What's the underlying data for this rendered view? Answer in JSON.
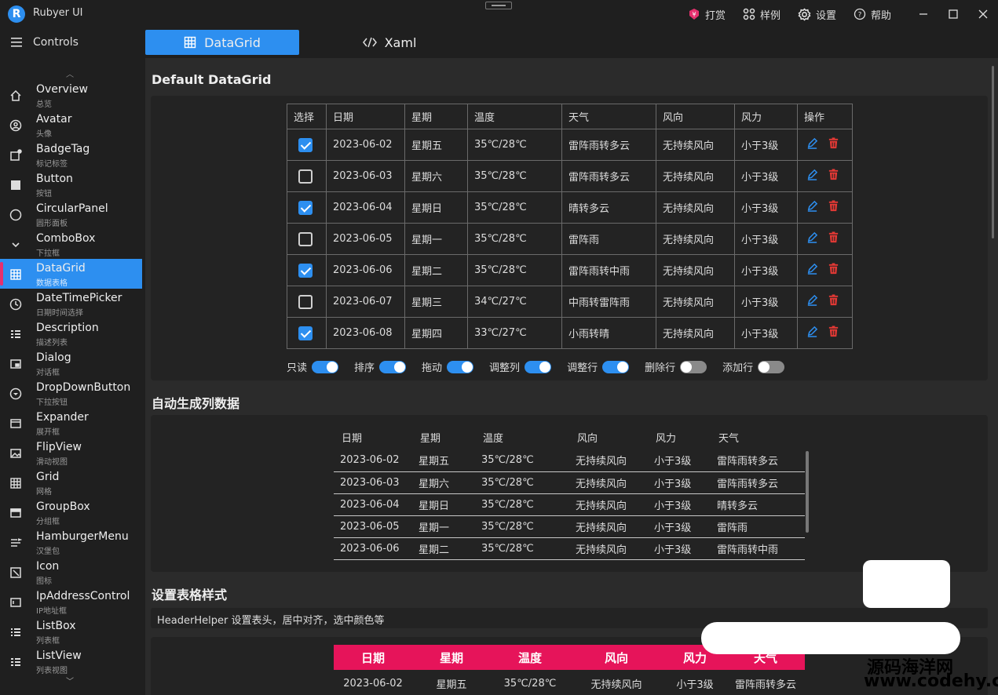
{
  "app": {
    "title": "Rubyer UI",
    "logo_letter": "R",
    "accent": "#2d8ff0",
    "highlight": "#e6145a"
  },
  "titlebar": {
    "items": [
      {
        "label": "打赏",
        "icon": "donate-icon"
      },
      {
        "label": "样例",
        "icon": "grid-icon"
      },
      {
        "label": "设置",
        "icon": "gear-icon"
      },
      {
        "label": "帮助",
        "icon": "help-icon"
      }
    ]
  },
  "sidebar": {
    "header": "Controls",
    "items": [
      {
        "en": "Overview",
        "zh": "总览"
      },
      {
        "en": "Avatar",
        "zh": "头像"
      },
      {
        "en": "BadgeTag",
        "zh": "标记标签"
      },
      {
        "en": "Button",
        "zh": "按钮"
      },
      {
        "en": "CircularPanel",
        "zh": "圆形面板"
      },
      {
        "en": "ComboBox",
        "zh": "下拉框"
      },
      {
        "en": "DataGrid",
        "zh": "数据表格"
      },
      {
        "en": "DateTimePicker",
        "zh": "日期时间选择"
      },
      {
        "en": "Description",
        "zh": "描述列表"
      },
      {
        "en": "Dialog",
        "zh": "对话框"
      },
      {
        "en": "DropDownButton",
        "zh": "下拉按钮"
      },
      {
        "en": "Expander",
        "zh": "展开框"
      },
      {
        "en": "FlipView",
        "zh": "滑动视图"
      },
      {
        "en": "Grid",
        "zh": "网格"
      },
      {
        "en": "GroupBox",
        "zh": "分组框"
      },
      {
        "en": "HamburgerMenu",
        "zh": "汉堡包"
      },
      {
        "en": "Icon",
        "zh": "图标"
      },
      {
        "en": "IpAddressControl",
        "zh": "IP地址框"
      },
      {
        "en": "ListBox",
        "zh": "列表框"
      },
      {
        "en": "ListView",
        "zh": "列表视图"
      }
    ]
  },
  "tabs": {
    "datagrid": "DataGrid",
    "xaml": "Xaml"
  },
  "section1": {
    "title": "Default DataGrid",
    "headers": [
      "选择",
      "日期",
      "星期",
      "温度",
      "天气",
      "风向",
      "风力",
      "操作"
    ],
    "rows": [
      {
        "checked": true,
        "date": "2023-06-02",
        "weekday": "星期五",
        "temp": "35℃/28℃",
        "weather": "雷阵雨转多云",
        "wind_dir": "无持续风向",
        "wind": "小于3级"
      },
      {
        "checked": false,
        "date": "2023-06-03",
        "weekday": "星期六",
        "temp": "35℃/28℃",
        "weather": "雷阵雨转多云",
        "wind_dir": "无持续风向",
        "wind": "小于3级"
      },
      {
        "checked": true,
        "date": "2023-06-04",
        "weekday": "星期日",
        "temp": "35℃/28℃",
        "weather": "晴转多云",
        "wind_dir": "无持续风向",
        "wind": "小于3级"
      },
      {
        "checked": false,
        "date": "2023-06-05",
        "weekday": "星期一",
        "temp": "35℃/28℃",
        "weather": "雷阵雨",
        "wind_dir": "无持续风向",
        "wind": "小于3级"
      },
      {
        "checked": true,
        "date": "2023-06-06",
        "weekday": "星期二",
        "temp": "35℃/28℃",
        "weather": "雷阵雨转中雨",
        "wind_dir": "无持续风向",
        "wind": "小于3级"
      },
      {
        "checked": false,
        "date": "2023-06-07",
        "weekday": "星期三",
        "temp": "34℃/27℃",
        "weather": "中雨转雷阵雨",
        "wind_dir": "无持续风向",
        "wind": "小于3级"
      },
      {
        "checked": true,
        "date": "2023-06-08",
        "weekday": "星期四",
        "temp": "33℃/27℃",
        "weather": "小雨转晴",
        "wind_dir": "无持续风向",
        "wind": "小于3级"
      }
    ],
    "toggles": [
      {
        "label": "只读",
        "on": true
      },
      {
        "label": "排序",
        "on": true
      },
      {
        "label": "拖动",
        "on": true
      },
      {
        "label": "调整列",
        "on": true
      },
      {
        "label": "调整行",
        "on": true
      },
      {
        "label": "删除行",
        "on": false
      },
      {
        "label": "添加行",
        "on": false
      }
    ]
  },
  "section2": {
    "title": "自动生成列数据",
    "headers": [
      "日期",
      "星期",
      "温度",
      "风向",
      "风力",
      "天气"
    ],
    "rows": [
      [
        "2023-06-02",
        "星期五",
        "35℃/28℃",
        "无持续风向",
        "小于3级",
        "雷阵雨转多云"
      ],
      [
        "2023-06-03",
        "星期六",
        "35℃/28℃",
        "无持续风向",
        "小于3级",
        "雷阵雨转多云"
      ],
      [
        "2023-06-04",
        "星期日",
        "35℃/28℃",
        "无持续风向",
        "小于3级",
        "晴转多云"
      ],
      [
        "2023-06-05",
        "星期一",
        "35℃/28℃",
        "无持续风向",
        "小于3级",
        "雷阵雨"
      ],
      [
        "2023-06-06",
        "星期二",
        "35℃/28℃",
        "无持续风向",
        "小于3级",
        "雷阵雨转中雨"
      ]
    ]
  },
  "section3": {
    "title": "设置表格样式",
    "description": "HeaderHelper 设置表头，居中对齐，选中颜色等",
    "headers": [
      "日期",
      "星期",
      "温度",
      "风向",
      "风力",
      "天气"
    ],
    "rows": [
      [
        "2023-06-02",
        "星期五",
        "35℃/28℃",
        "无持续风向",
        "小于3级",
        "雷阵雨转多云"
      ]
    ]
  },
  "watermark": {
    "line1": "源码海洋网",
    "line2": "www.codehy.com"
  }
}
